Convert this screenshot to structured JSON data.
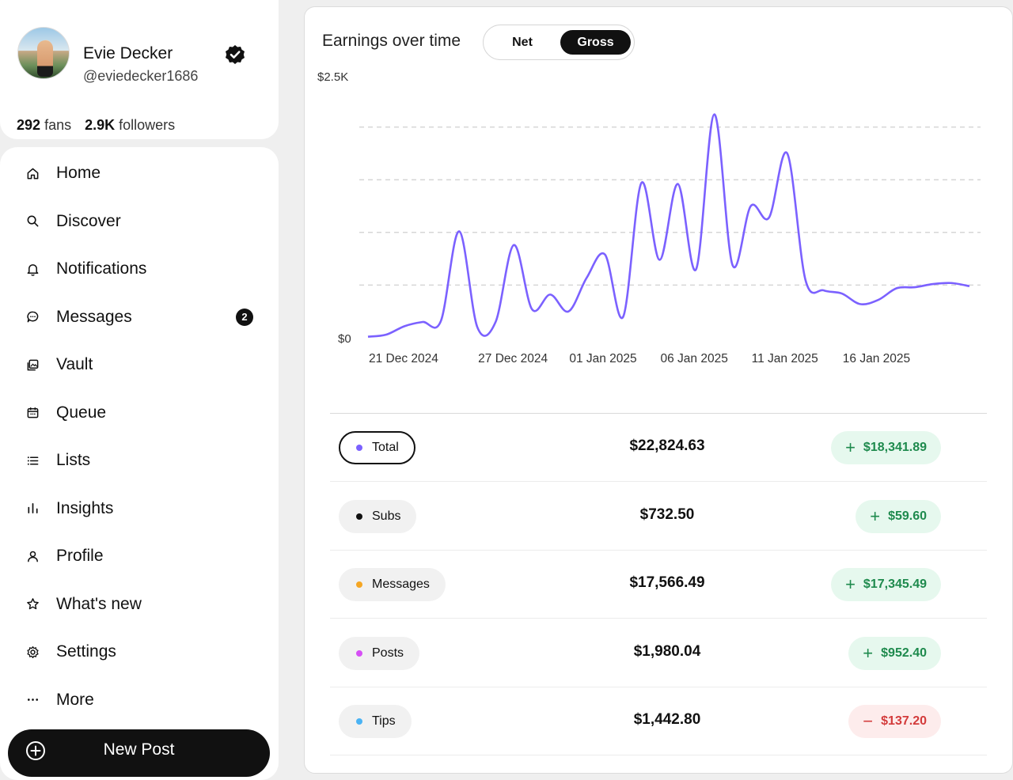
{
  "profile": {
    "name": "Evie Decker",
    "handle": "@eviedecker1686",
    "fans_count": "292",
    "fans_label": "fans",
    "followers_count": "2.9K",
    "followers_label": "followers",
    "verified_icon": "verified-check-icon"
  },
  "nav": {
    "items": [
      {
        "label": "Home",
        "icon": "home-icon"
      },
      {
        "label": "Discover",
        "icon": "search-icon"
      },
      {
        "label": "Notifications",
        "icon": "bell-icon"
      },
      {
        "label": "Messages",
        "icon": "chat-bubble-icon",
        "badge": "2"
      },
      {
        "label": "Vault",
        "icon": "image-stack-icon"
      },
      {
        "label": "Queue",
        "icon": "calendar-icon"
      },
      {
        "label": "Lists",
        "icon": "list-icon"
      },
      {
        "label": "Insights",
        "icon": "bar-chart-icon"
      },
      {
        "label": "Profile",
        "icon": "user-icon"
      },
      {
        "label": "What's new",
        "icon": "star-icon"
      },
      {
        "label": "Settings",
        "icon": "gear-icon"
      },
      {
        "label": "More",
        "icon": "ellipsis-icon"
      }
    ],
    "new_post_label": "New Post"
  },
  "earnings": {
    "title": "Earnings over time",
    "toggle": {
      "options": [
        "Net",
        "Gross"
      ],
      "selected": "Gross"
    },
    "rows": [
      {
        "label": "Total",
        "dot_color": "#7b61ff",
        "amount": "$22,824.63",
        "delta": "$18,341.89",
        "direction": "up",
        "active": true
      },
      {
        "label": "Subs",
        "dot_color": "#111111",
        "amount": "$732.50",
        "delta": "$59.60",
        "direction": "up",
        "active": false
      },
      {
        "label": "Messages",
        "dot_color": "#f5a623",
        "amount": "$17,566.49",
        "delta": "$17,345.49",
        "direction": "up",
        "active": false
      },
      {
        "label": "Posts",
        "dot_color": "#d64ff5",
        "amount": "$1,980.04",
        "delta": "$952.40",
        "direction": "up",
        "active": false
      },
      {
        "label": "Tips",
        "dot_color": "#4ab3f4",
        "amount": "$1,442.80",
        "delta": "$137.20",
        "direction": "down",
        "active": false
      }
    ]
  },
  "colors": {
    "accent": "#7b61ff",
    "positive": "#1e8a4d",
    "negative": "#d33b3b"
  },
  "chart_data": {
    "type": "line",
    "title": "Earnings over time",
    "y_tick_labels": [
      "$0",
      "$2.5K"
    ],
    "ylim": [
      0,
      2500
    ],
    "grid": true,
    "x_tick_labels": [
      "21 Dec 2024",
      "27 Dec 2024",
      "01 Jan 2025",
      "06 Jan 2025",
      "11 Jan 2025",
      "16 Jan 2025"
    ],
    "x": [
      "2024-12-21",
      "2024-12-22",
      "2024-12-23",
      "2024-12-24",
      "2024-12-25",
      "2024-12-26",
      "2024-12-27",
      "2024-12-28",
      "2024-12-29",
      "2024-12-30",
      "2024-12-31",
      "2025-01-01",
      "2025-01-02",
      "2025-01-03",
      "2025-01-04",
      "2025-01-05",
      "2025-01-06",
      "2025-01-07",
      "2025-01-08",
      "2025-01-09",
      "2025-01-10",
      "2025-01-11",
      "2025-01-12",
      "2025-01-13",
      "2025-01-14",
      "2025-01-15",
      "2025-01-16",
      "2025-01-17",
      "2025-01-18",
      "2025-01-19",
      "2025-01-20",
      "2025-01-21",
      "2025-01-22",
      "2025-01-23"
    ],
    "series": [
      {
        "color": "#7b61ff",
        "values": [
          10,
          30,
          110,
          150,
          160,
          1010,
          100,
          150,
          880,
          270,
          410,
          250,
          570,
          790,
          200,
          1470,
          740,
          1460,
          650,
          2120,
          690,
          1250,
          1140,
          1750,
          550,
          450,
          420,
          320,
          360,
          470,
          480,
          510,
          520,
          490
        ]
      }
    ]
  }
}
